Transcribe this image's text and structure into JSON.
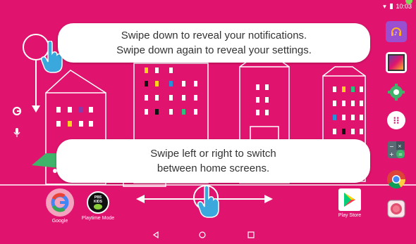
{
  "status_bar": {
    "time": "10:03"
  },
  "tutorial": {
    "notifications_line1": "Swipe down to reveal your notifications.",
    "notifications_line2": "Swipe down again to reveal your settings.",
    "homescreens_line1": "Swipe left or right to switch",
    "homescreens_line2": "between home screens."
  },
  "home_apps": [
    {
      "label": "Google",
      "icon": "google-icon"
    },
    {
      "label": "Playtime Mode",
      "icon": "pbs-kids-icon",
      "badge": "PBS KIDS"
    },
    {
      "label": "Play Store",
      "icon": "play-store-icon"
    }
  ],
  "side_icons": [
    "google-g-icon",
    "microphone-icon"
  ],
  "dock_icons": [
    "music-icon",
    "gallery-icon",
    "settings-icon",
    "app-drawer-icon",
    "calculator-icon",
    "chrome-icon",
    "camera-icon"
  ],
  "nav_icons": [
    "back-icon",
    "home-icon",
    "recents-icon"
  ],
  "colors": {
    "background": "#e0146e",
    "bubble": "#ffffff",
    "hand": "#3aa7dd"
  }
}
